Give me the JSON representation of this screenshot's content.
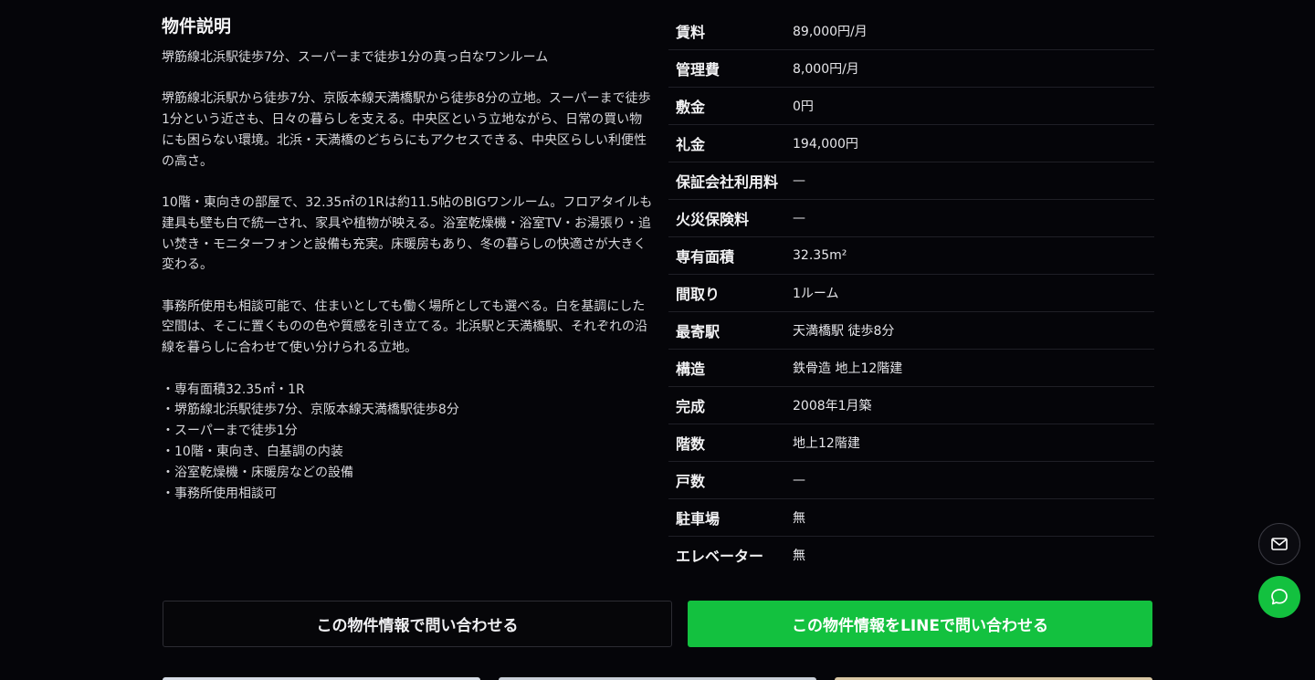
{
  "description": {
    "title": "物件説明",
    "paragraphs": [
      "堺筋線北浜駅徒歩7分、スーパーまで徒歩1分の真っ白なワンルーム",
      "堺筋線北浜駅から徒歩7分、京阪本線天満橋駅から徒歩8分の立地。スーパーまで徒歩1分という近さも、日々の暮らしを支える。中央区という立地ながら、日常の買い物にも困らない環境。北浜・天満橋のどちらにもアクセスできる、中央区らしい利便性の高さ。",
      "10階・東向きの部屋で、32.35㎡の1Rは約11.5帖のBIGワンルーム。フロアタイルも建具も壁も白で統一され、家具や植物が映える。浴室乾燥機・浴室TV・お湯張り・追い焚き・モニターフォンと設備も充実。床暖房もあり、冬の暮らしの快適さが大きく変わる。",
      "事務所使用も相談可能で、住まいとしても働く場所としても選べる。白を基調にした空間は、そこに置くものの色や質感を引き立てる。北浜駅と天満橋駅、それぞれの沿線を暮らしに合わせて使い分けられる立地。"
    ],
    "bullets": [
      "・専有面積32.35㎡・1R",
      "・堺筋線北浜駅徒歩7分、京阪本線天満橋駅徒歩8分",
      "・スーパーまで徒歩1分",
      "・10階・東向き、白基調の内装",
      "・浴室乾燥機・床暖房などの設備",
      "・事務所使用相談可"
    ]
  },
  "specs": [
    {
      "label": "賃料",
      "value": "89,000円/月"
    },
    {
      "label": "管理費",
      "value": "8,000円/月"
    },
    {
      "label": "敷金",
      "value": "0円"
    },
    {
      "label": "礼金",
      "value": "194,000円"
    },
    {
      "label": "保証会社利用料",
      "value": "—"
    },
    {
      "label": "火災保険料",
      "value": "—"
    },
    {
      "label": "専有面積",
      "value": "32.35m²"
    },
    {
      "label": "間取り",
      "value": "1ルーム"
    },
    {
      "label": "最寄駅",
      "value": "天満橋駅 徒歩8分"
    },
    {
      "label": "構造",
      "value": "鉄骨造 地上12階建"
    },
    {
      "label": "完成",
      "value": "2008年1月築"
    },
    {
      "label": "階数",
      "value": "地上12階建"
    },
    {
      "label": "戸数",
      "value": "—"
    },
    {
      "label": "駐車場",
      "value": "無"
    },
    {
      "label": "エレベーター",
      "value": "無"
    }
  ],
  "actions": {
    "contact_label": "この物件情報で問い合わせる",
    "line_label": "この物件情報をLINEで問い合わせる"
  },
  "floating": {
    "mail_icon": "mail-icon",
    "chat_icon": "chat-bubble-icon"
  },
  "colors": {
    "background": "#050509",
    "line_green": "#13c13f"
  }
}
